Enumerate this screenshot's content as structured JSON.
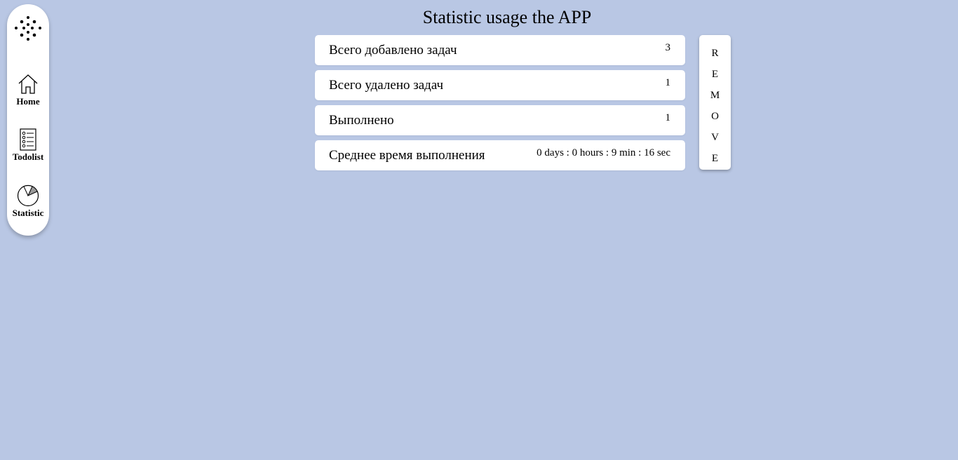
{
  "sidebar": {
    "items": [
      {
        "label": "Home",
        "icon": "home-icon"
      },
      {
        "label": "Todolist",
        "icon": "list-icon"
      },
      {
        "label": "Statistic",
        "icon": "pie-chart-icon"
      }
    ],
    "logo_icon": "dots-logo-icon"
  },
  "main": {
    "title": "Statistic usage the APP",
    "stats": [
      {
        "label": "Всего добавлено задач",
        "value": "3"
      },
      {
        "label": "Всего удалено задач",
        "value": "1"
      },
      {
        "label": "Выполнено",
        "value": "1"
      },
      {
        "label": "Среднее время выполнения",
        "value": "0 days : 0 hours : 9 min : 16 sec"
      }
    ],
    "remove_letters": [
      "R",
      "E",
      "M",
      "O",
      "V",
      "E"
    ]
  },
  "colors": {
    "background": "#b9c7e4",
    "card": "#ffffff",
    "text": "#000000"
  }
}
